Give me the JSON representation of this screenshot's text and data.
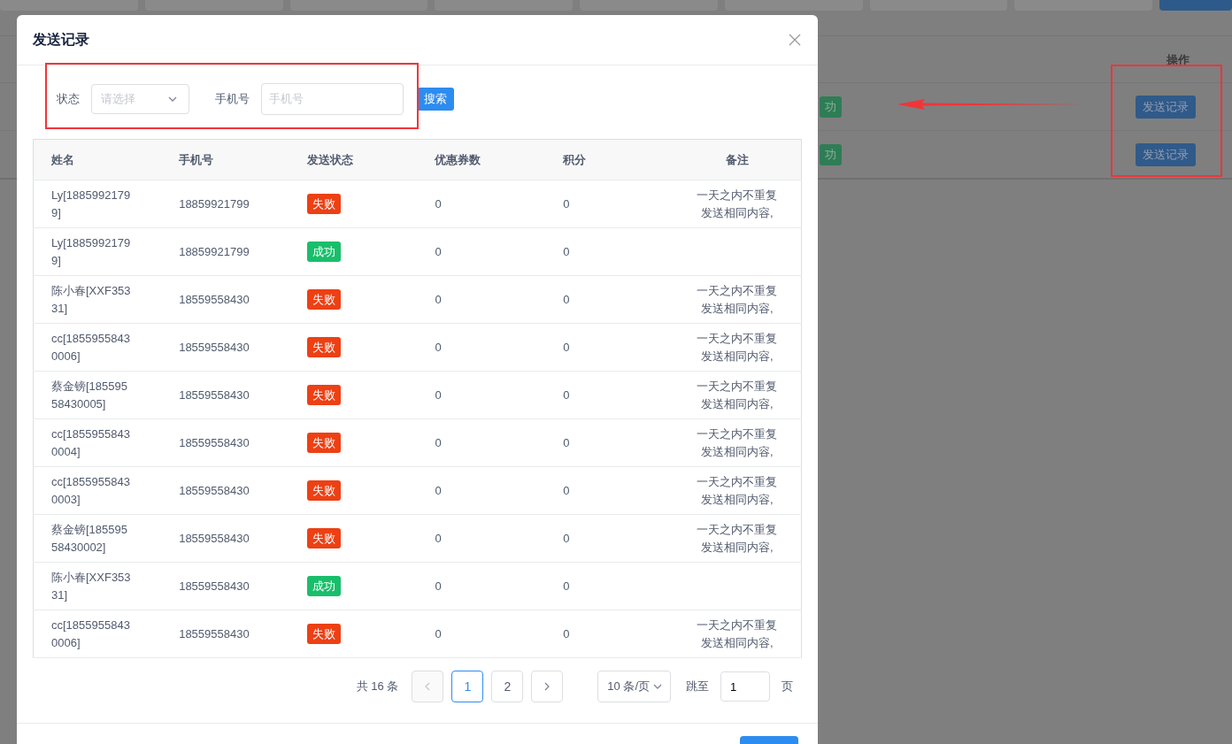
{
  "background": {
    "column_header": "操作",
    "rows": [
      {
        "status_tag": "功",
        "action": "发送记录"
      },
      {
        "status_tag": "功",
        "action": "发送记录"
      }
    ]
  },
  "modal": {
    "title": "发送记录",
    "filters": {
      "status_label": "状态",
      "status_placeholder": "请选择",
      "phone_label": "手机号",
      "phone_placeholder": "手机号",
      "search_button": "搜索"
    },
    "table": {
      "columns": [
        "姓名",
        "手机号",
        "发送状态",
        "优惠券数",
        "积分",
        "备注"
      ],
      "rows": [
        {
          "name": "Ly[18859921799]",
          "phone": "18859921799",
          "status": {
            "text": "失败",
            "kind": "fail"
          },
          "coupons": "0",
          "points": "0",
          "remark": "一天之内不重复发送相同内容,"
        },
        {
          "name": "Ly[18859921799]",
          "phone": "18859921799",
          "status": {
            "text": "成功",
            "kind": "success"
          },
          "coupons": "0",
          "points": "0"
        },
        {
          "name": "陈小春[XXF35331]",
          "phone": "18559558430",
          "status": {
            "text": "失败",
            "kind": "fail"
          },
          "coupons": "0",
          "points": "0",
          "remark": "一天之内不重复发送相同内容,"
        },
        {
          "name": "cc[18559558430006]",
          "phone": "18559558430",
          "status": {
            "text": "失败",
            "kind": "fail"
          },
          "coupons": "0",
          "points": "0",
          "remark": "一天之内不重复发送相同内容,"
        },
        {
          "name": "蔡金镑[18559558430005]",
          "phone": "18559558430",
          "status": {
            "text": "失败",
            "kind": "fail"
          },
          "coupons": "0",
          "points": "0",
          "remark": "一天之内不重复发送相同内容,"
        },
        {
          "name": "cc[18559558430004]",
          "phone": "18559558430",
          "status": {
            "text": "失败",
            "kind": "fail"
          },
          "coupons": "0",
          "points": "0",
          "remark": "一天之内不重复发送相同内容,"
        },
        {
          "name": "cc[18559558430003]",
          "phone": "18559558430",
          "status": {
            "text": "失败",
            "kind": "fail"
          },
          "coupons": "0",
          "points": "0",
          "remark": "一天之内不重复发送相同内容,"
        },
        {
          "name": "蔡金镑[18559558430002]",
          "phone": "18559558430",
          "status": {
            "text": "失败",
            "kind": "fail"
          },
          "coupons": "0",
          "points": "0",
          "remark": "一天之内不重复发送相同内容,"
        },
        {
          "name": "陈小春[XXF35331]",
          "phone": "18559558430",
          "status": {
            "text": "成功",
            "kind": "success"
          },
          "coupons": "0",
          "points": "0"
        },
        {
          "name": "cc[18559558430006]",
          "phone": "18559558430",
          "status": {
            "text": "失败",
            "kind": "fail"
          },
          "coupons": "0",
          "points": "0",
          "remark": "一天之内不重复发送相同内容,"
        }
      ]
    },
    "pagination": {
      "total": "共 16 条",
      "prev_disabled": true,
      "pages": [
        {
          "label": "1",
          "selected": true
        },
        {
          "label": "2",
          "selected": false
        }
      ],
      "page_size": "10 条/页",
      "jump_label": "跳至",
      "jump_value": "1",
      "page_suffix": "页"
    }
  }
}
